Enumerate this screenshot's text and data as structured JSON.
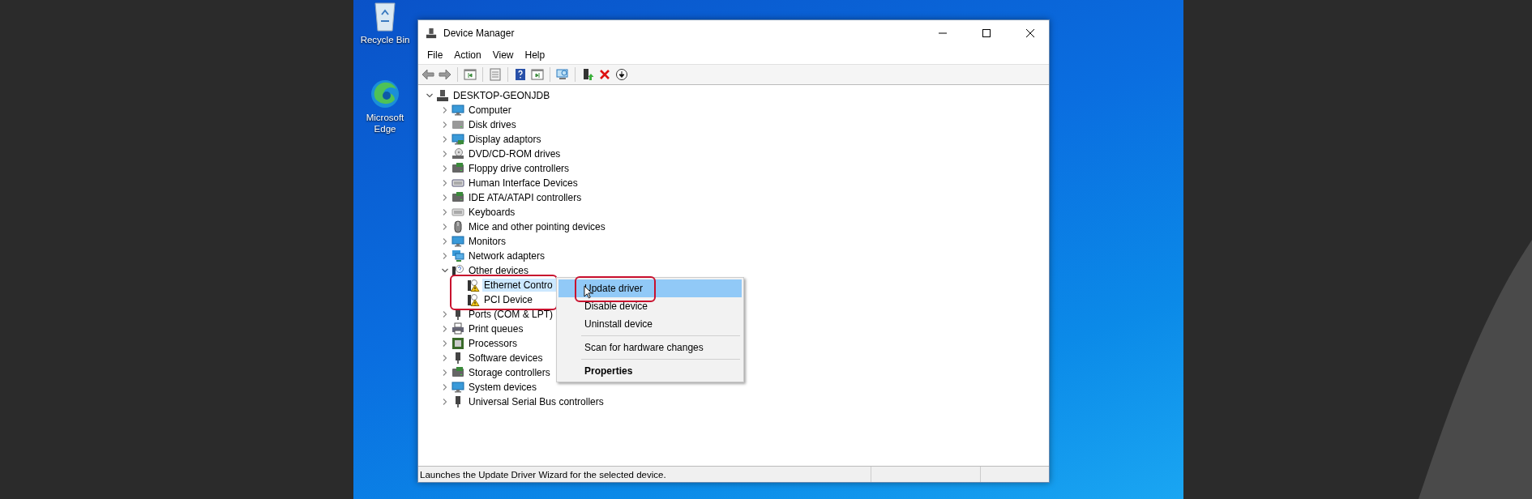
{
  "desktop_icons": [
    {
      "label": "Recycle Bin",
      "kind": "recycle"
    },
    {
      "label": "Microsoft Edge",
      "kind": "edge"
    }
  ],
  "window": {
    "title": "Device Manager"
  },
  "menu": [
    "File",
    "Action",
    "View",
    "Help"
  ],
  "toolbar": [
    {
      "kind": "back"
    },
    {
      "kind": "forward"
    },
    {
      "kind": "separator"
    },
    {
      "kind": "console-tree"
    },
    {
      "kind": "separator"
    },
    {
      "kind": "properties"
    },
    {
      "kind": "separator"
    },
    {
      "kind": "help"
    },
    {
      "kind": "action-pane"
    },
    {
      "kind": "separator"
    },
    {
      "kind": "scan"
    },
    {
      "kind": "separator"
    },
    {
      "kind": "update"
    },
    {
      "kind": "uninstall"
    },
    {
      "kind": "disable"
    }
  ],
  "tree": {
    "label": "DESKTOP-GEONJDB",
    "kind": "pc",
    "expanded": true,
    "children": [
      {
        "label": "Computer",
        "kind": "computer",
        "expanded": false
      },
      {
        "label": "Disk drives",
        "kind": "disk",
        "expanded": false
      },
      {
        "label": "Display adaptors",
        "kind": "display",
        "expanded": false
      },
      {
        "label": "DVD/CD-ROM drives",
        "kind": "dvd",
        "expanded": false
      },
      {
        "label": "Floppy drive controllers",
        "kind": "floppy",
        "expanded": false
      },
      {
        "label": "Human Interface Devices",
        "kind": "hid",
        "expanded": false
      },
      {
        "label": "IDE ATA/ATAPI controllers",
        "kind": "ide",
        "expanded": false
      },
      {
        "label": "Keyboards",
        "kind": "keyboard",
        "expanded": false
      },
      {
        "label": "Mice and other pointing devices",
        "kind": "mouse",
        "expanded": false
      },
      {
        "label": "Monitors",
        "kind": "monitor",
        "expanded": false
      },
      {
        "label": "Network adapters",
        "kind": "network",
        "expanded": false
      },
      {
        "label": "Other devices",
        "kind": "unknown",
        "expanded": true,
        "highlight_children": true,
        "children": [
          {
            "label": "Ethernet Contro",
            "kind": "warning",
            "selected": true
          },
          {
            "label": "PCI Device",
            "kind": "warning",
            "selected": false
          }
        ]
      },
      {
        "label": "Ports (COM & LPT)",
        "kind": "port",
        "expanded": false
      },
      {
        "label": "Print queues",
        "kind": "printer",
        "expanded": false
      },
      {
        "label": "Processors",
        "kind": "processor",
        "expanded": false
      },
      {
        "label": "Software devices",
        "kind": "software",
        "expanded": false
      },
      {
        "label": "Storage controllers",
        "kind": "storage",
        "expanded": false
      },
      {
        "label": "System devices",
        "kind": "system",
        "expanded": false
      },
      {
        "label": "Universal Serial Bus controllers",
        "kind": "usb",
        "expanded": false
      }
    ]
  },
  "context_menu": {
    "groups": [
      [
        {
          "label": "Update driver",
          "bold": false,
          "selected": true,
          "annotated": true
        },
        {
          "label": "Disable device",
          "bold": false,
          "selected": false,
          "annotated": false
        },
        {
          "label": "Uninstall device",
          "bold": false,
          "selected": false,
          "annotated": false
        }
      ],
      [
        {
          "label": "Scan for hardware changes",
          "bold": false,
          "selected": false,
          "annotated": false
        }
      ],
      [
        {
          "label": "Properties",
          "bold": true,
          "selected": false,
          "annotated": false
        }
      ]
    ]
  },
  "status_bar": {
    "text": "Launches the Update Driver Wizard for the selected device."
  }
}
